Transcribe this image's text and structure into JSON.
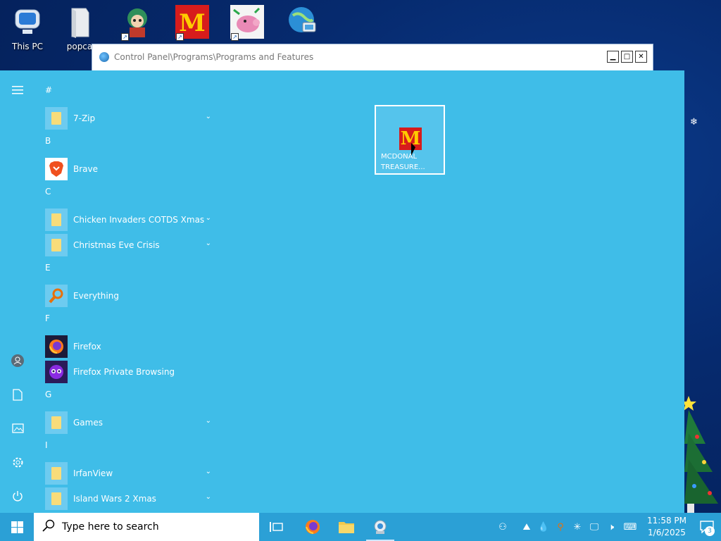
{
  "desktop": {
    "icons": [
      {
        "label": "This PC",
        "icon": "this-pc-icon"
      },
      {
        "label": "popca",
        "icon": "folder-icon"
      },
      {
        "label": "",
        "icon": "game-character-icon"
      },
      {
        "label": "",
        "icon": "mcdonalds-icon"
      },
      {
        "label": "",
        "icon": "pig-game-icon"
      },
      {
        "label": "",
        "icon": "globe-icon"
      }
    ]
  },
  "window": {
    "title": "Control Panel\\Programs\\Programs and Features",
    "minimize": "▁",
    "maximize": "□",
    "close": "✕"
  },
  "start_menu": {
    "groups": [
      {
        "letter": "#",
        "apps": [
          {
            "name": "7-Zip",
            "icon": "folder-icon",
            "expandable": true
          }
        ]
      },
      {
        "letter": "B",
        "apps": [
          {
            "name": "Brave",
            "icon": "brave-icon",
            "expandable": false
          }
        ]
      },
      {
        "letter": "C",
        "apps": [
          {
            "name": "Chicken Invaders COTDS Xmas",
            "icon": "folder-icon",
            "expandable": true
          },
          {
            "name": "Christmas Eve Crisis",
            "icon": "folder-icon",
            "expandable": true
          }
        ]
      },
      {
        "letter": "E",
        "apps": [
          {
            "name": "Everything",
            "icon": "everything-icon",
            "expandable": false
          }
        ]
      },
      {
        "letter": "F",
        "apps": [
          {
            "name": "Firefox",
            "icon": "firefox-icon",
            "expandable": false
          },
          {
            "name": "Firefox Private Browsing",
            "icon": "firefox-private-icon",
            "expandable": false
          }
        ]
      },
      {
        "letter": "G",
        "apps": [
          {
            "name": "Games",
            "icon": "folder-icon",
            "expandable": true
          }
        ]
      },
      {
        "letter": "I",
        "apps": [
          {
            "name": "IrfanView",
            "icon": "folder-icon",
            "expandable": true
          },
          {
            "name": "Island Wars 2 Xmas",
            "icon": "folder-icon",
            "expandable": true
          }
        ]
      }
    ],
    "tile": {
      "caption": "MCDONAL\nTREASURE...",
      "logo": "M"
    },
    "rail": [
      "hamburger-icon",
      "user-icon",
      "documents-icon",
      "pictures-icon",
      "settings-icon",
      "power-icon"
    ]
  },
  "taskbar": {
    "search_placeholder": "Type here to search",
    "clock_time": "11:58 PM",
    "clock_date": "1/6/2025",
    "notification_count": "3"
  },
  "colors": {
    "start_menu_bg": "#3fbde8",
    "taskbar_bg": "#2ba0d6",
    "desktop_bg": "#062a6e"
  }
}
